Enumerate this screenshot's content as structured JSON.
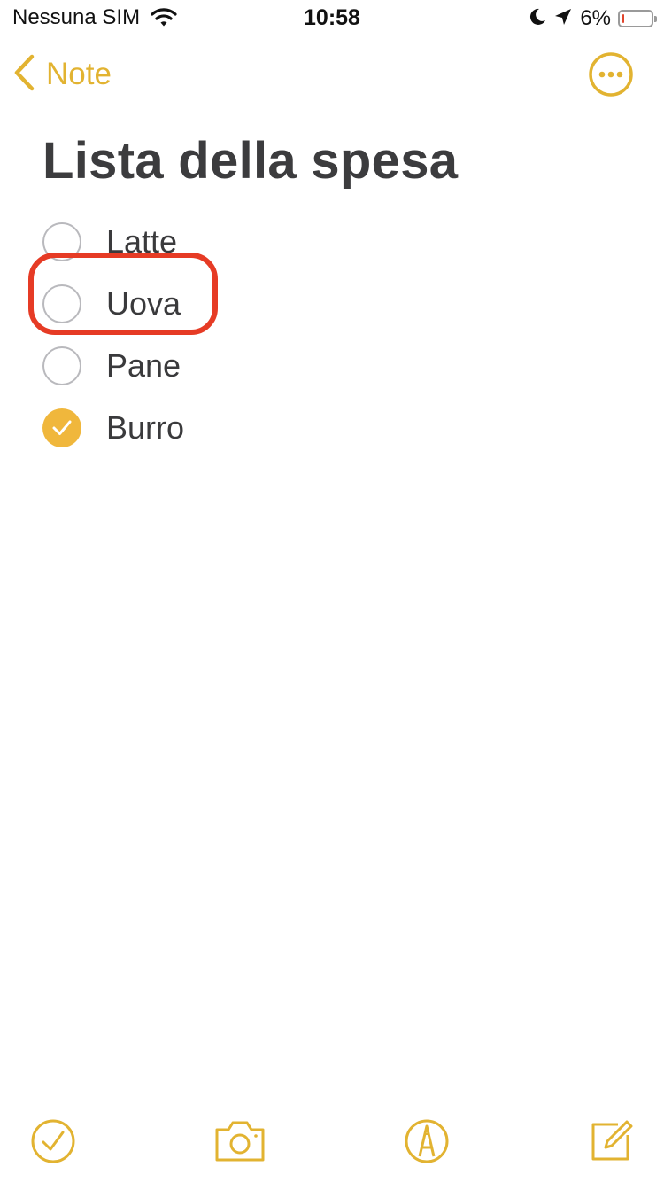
{
  "status_bar": {
    "carrier": "Nessuna SIM",
    "time": "10:58",
    "battery_percent": "6%",
    "battery_level": 0.06,
    "icons": [
      "wifi-icon",
      "moon-icon",
      "location-arrow-icon",
      "battery-icon"
    ]
  },
  "nav": {
    "back_label": "Note",
    "back_icon": "chevron-left-icon",
    "more_icon": "ellipsis-circle-icon"
  },
  "note": {
    "title": "Lista della spesa",
    "items": [
      {
        "label": "Latte",
        "checked": false
      },
      {
        "label": "Uova",
        "checked": false,
        "highlighted": true
      },
      {
        "label": "Pane",
        "checked": false
      },
      {
        "label": "Burro",
        "checked": true
      }
    ]
  },
  "toolbar": {
    "items": [
      "checklist-icon",
      "camera-icon",
      "markup-icon",
      "compose-icon"
    ]
  },
  "colors": {
    "accent": "#e2b331",
    "checked_fill": "#f0b73c",
    "highlight": "#e63b25",
    "text": "#3a3a3c"
  }
}
